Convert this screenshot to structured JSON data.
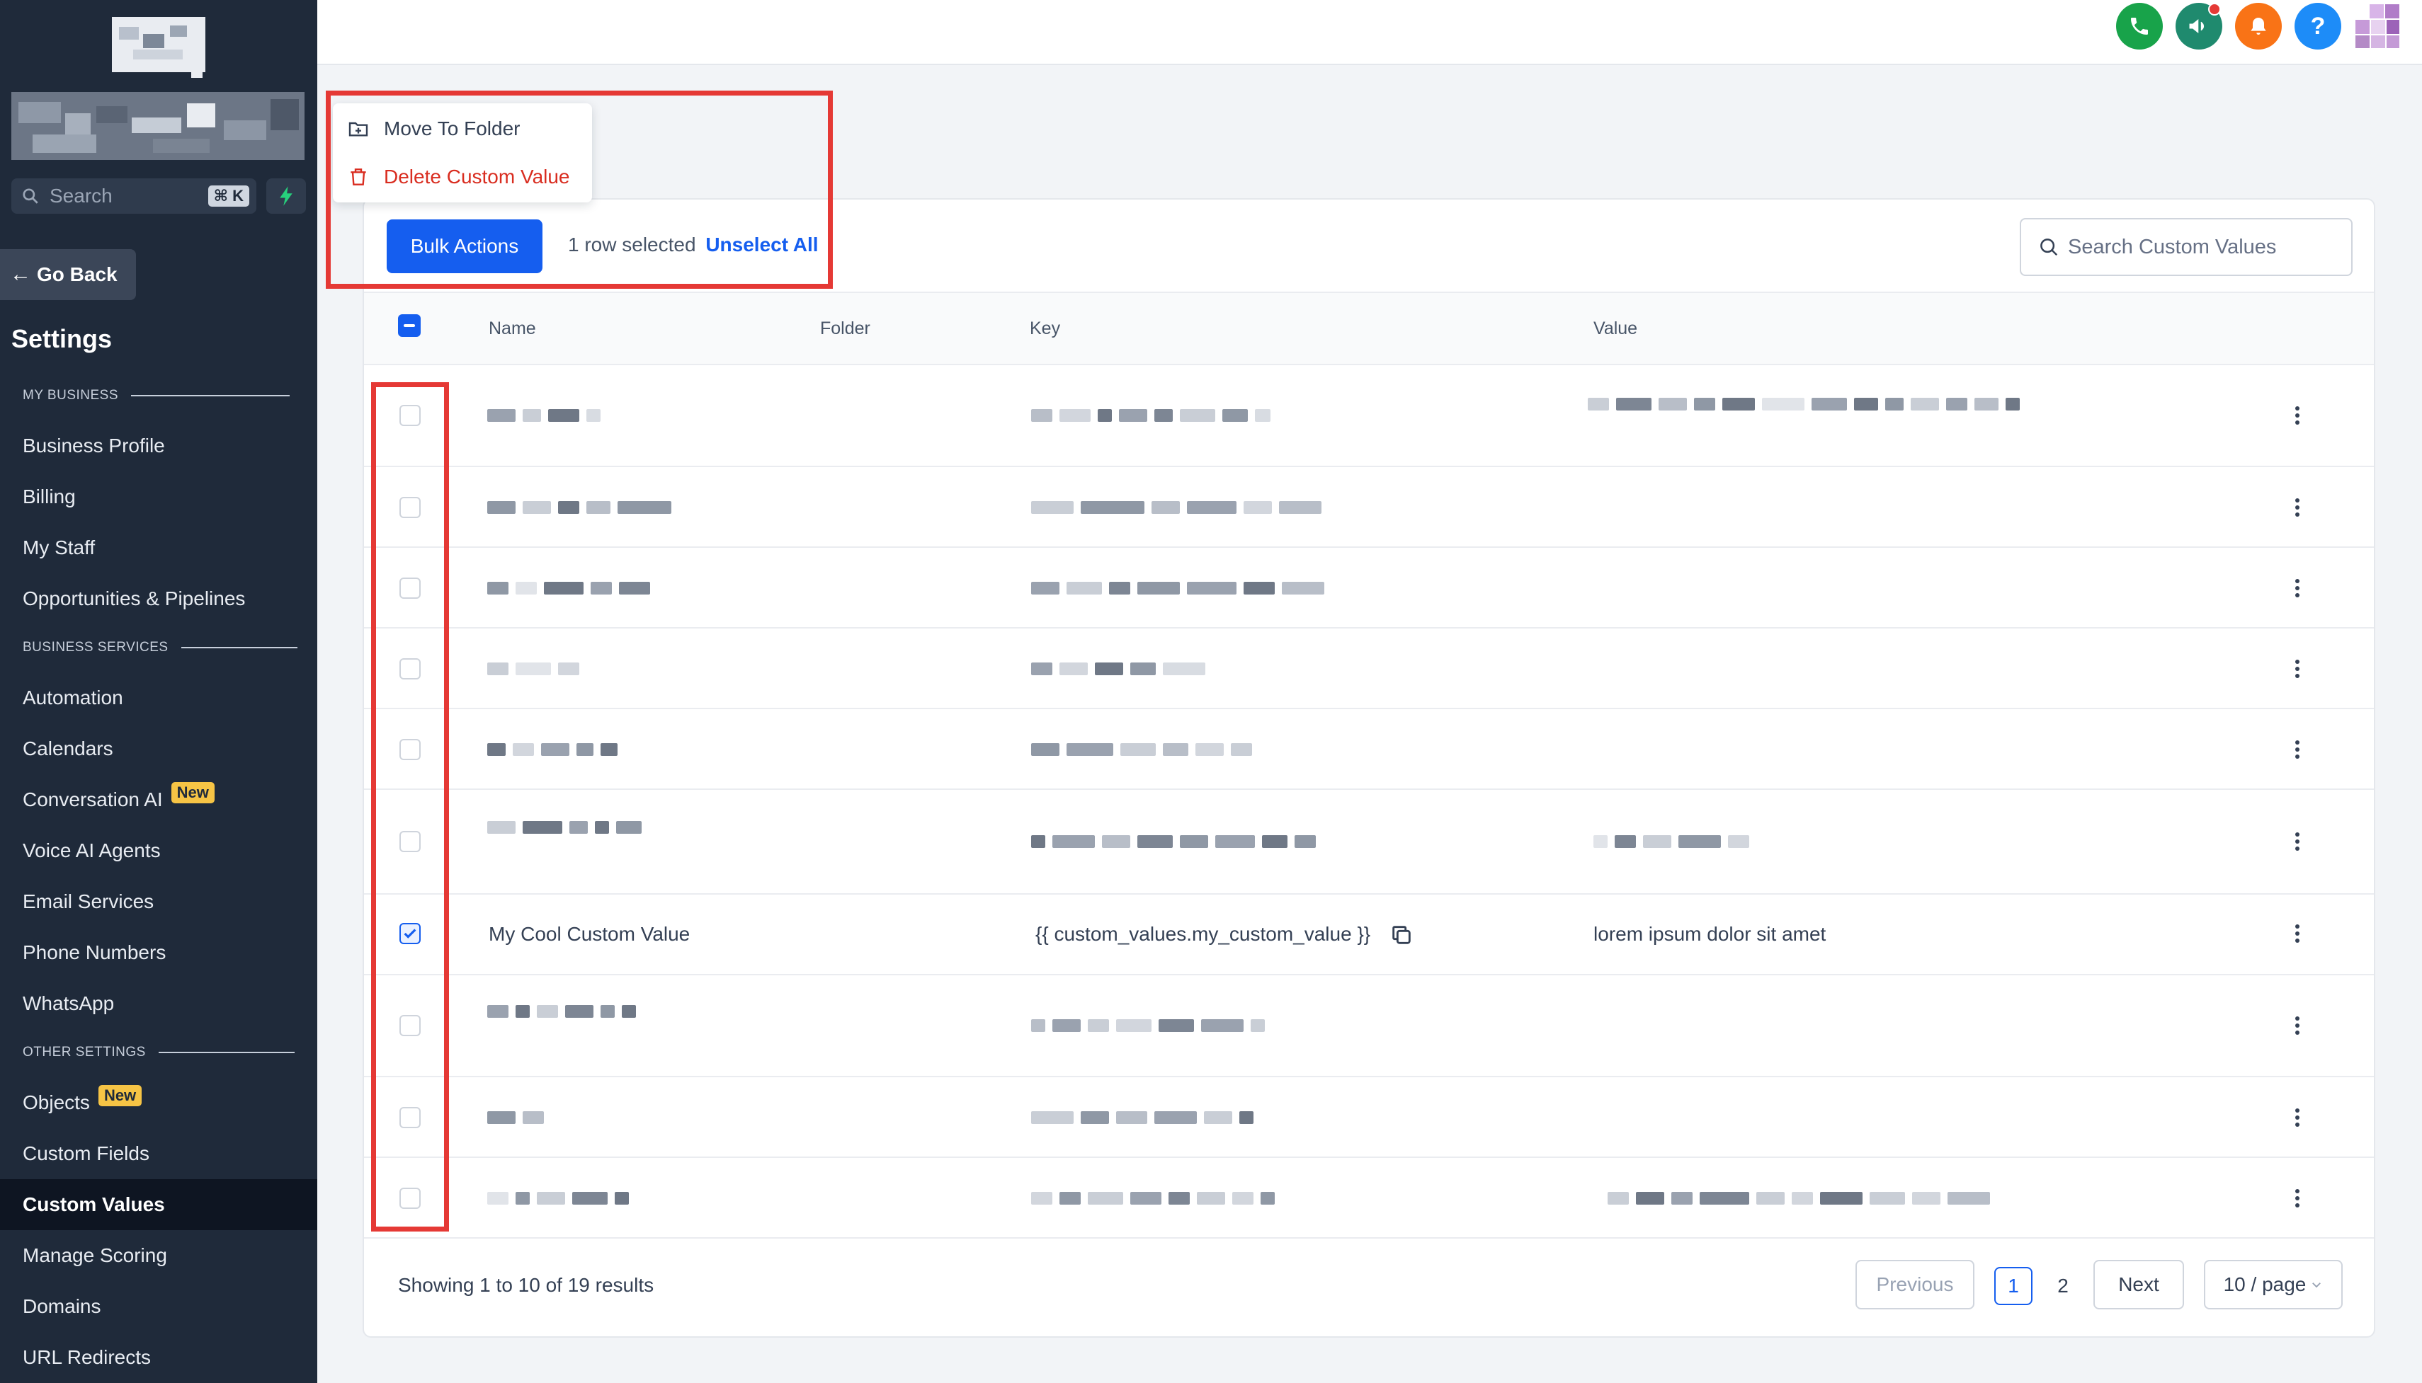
{
  "sidebar": {
    "search_placeholder": "Search",
    "search_shortcut": "⌘ K",
    "go_back": "Go Back",
    "title": "Settings",
    "sections": {
      "my_business": "MY BUSINESS",
      "business_services": "BUSINESS SERVICES",
      "other_settings": "OTHER SETTINGS"
    },
    "items": {
      "business_profile": "Business Profile",
      "billing": "Billing",
      "my_staff": "My Staff",
      "opportunities": "Opportunities & Pipelines",
      "automation": "Automation",
      "calendars": "Calendars",
      "conversation_ai": "Conversation AI",
      "voice_ai": "Voice AI Agents",
      "email_services": "Email Services",
      "phone_numbers": "Phone Numbers",
      "whatsapp": "WhatsApp",
      "objects": "Objects",
      "custom_fields": "Custom Fields",
      "custom_values": "Custom Values",
      "manage_scoring": "Manage Scoring",
      "domains": "Domains",
      "url_redirects": "URL Redirects"
    },
    "new_badge": "New",
    "active_item": "Custom Values"
  },
  "topbar": {
    "icons": [
      "phone-icon",
      "megaphone-icon",
      "bell-icon",
      "help-icon"
    ],
    "help_glyph": "?",
    "colors": {
      "phone": "#18a34a",
      "megaphone": "#1f8a6e",
      "bell": "#f97316",
      "help": "#1d8cf8"
    }
  },
  "dropdown": {
    "move": "Move To Folder",
    "delete": "Delete Custom Value"
  },
  "toolbar": {
    "bulk_actions": "Bulk Actions",
    "rows_selected": "1 row selected",
    "unselect_all": "Unselect All",
    "search_placeholder": "Search Custom Values"
  },
  "table": {
    "columns": {
      "name": "Name",
      "folder": "Folder",
      "key": "Key",
      "value": "Value"
    },
    "selected_row": {
      "name": "My Cool Custom Value",
      "key": "{{ custom_values.my_custom_value }}",
      "value": "lorem ipsum dolor sit amet"
    }
  },
  "footer": {
    "showing": "Showing 1 to 10 of 19 results",
    "previous": "Previous",
    "page1": "1",
    "page2": "2",
    "next": "Next",
    "page_size": "10 / page"
  },
  "colors": {
    "primary": "#155eef",
    "danger": "#d92d20",
    "highlight": "#e53935",
    "sidebar_bg": "#1f2a3a"
  }
}
